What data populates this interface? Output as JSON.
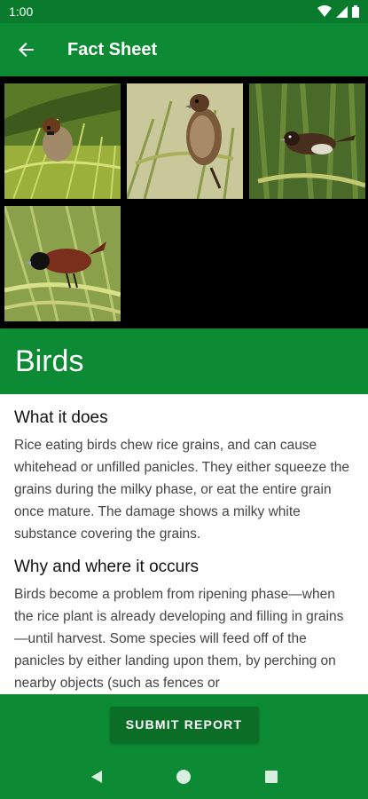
{
  "status_bar": {
    "time": "1:00",
    "icons": [
      "wifi-icon",
      "signal-icon",
      "battery-icon"
    ]
  },
  "app_bar": {
    "back_icon": "arrow-left-icon",
    "title": "Fact Sheet"
  },
  "gallery": {
    "images": [
      "sparrow-photo",
      "munia-photo-brown",
      "munia-photo-dark",
      "chestnut-munia-photo"
    ]
  },
  "page_title": "Birds",
  "sections": [
    {
      "heading": "What it does",
      "body": "Rice eating birds chew rice grains, and can cause whitehead or unfilled panicles. They either squeeze the grains during the milky phase, or eat the entire grain once mature. The damage shows a milky white substance covering the grains."
    },
    {
      "heading": "Why and where it occurs",
      "body": "Birds become a problem from ripening phase—when the rice plant is already developing and filling in grains—until harvest. Some species will feed off of the panicles by either landing upon them, by perching on nearby objects (such as fences or"
    }
  ],
  "bottom": {
    "submit_label": "SUBMIT REPORT"
  },
  "nav_bar": {
    "icons": [
      "back-triangle-icon",
      "home-circle-icon",
      "recents-square-icon"
    ]
  },
  "colors": {
    "primary": "#0d8a34",
    "primary_dark": "#0a7a2c",
    "button": "#0a6e27"
  }
}
